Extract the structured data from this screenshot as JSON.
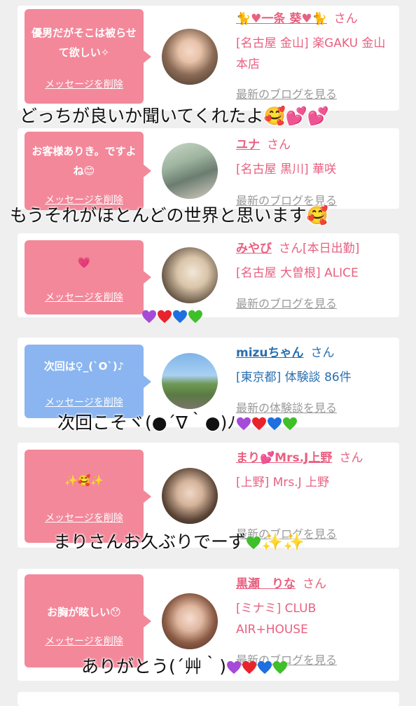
{
  "cards": [
    {
      "message": "優男だがそこは被らせて欲しい✧",
      "delete": "メッセージを削除",
      "name": "🐈♥一条 葵♥🐈",
      "san": "さん",
      "shop": "[名古屋 金山] 楽GAKU 金山本店",
      "blog": "最新のブログを見る"
    },
    {
      "message": "お客様ありき。ですよね😊",
      "delete": "メッセージを削除",
      "name": "ユナ",
      "san": "さん",
      "shop": "[名古屋 黒川] 華咲",
      "blog": "最新のブログを見る"
    },
    {
      "message": "💗",
      "delete": "メッセージを削除",
      "name": "みやび",
      "san": "さん[本日出勤]",
      "shop": "[名古屋 大曽根] ALICE",
      "blog": "最新のブログを見る"
    },
    {
      "message": "次回は♀_(`O`)♪",
      "delete": "メッセージを削除",
      "name": "mizuちゃん",
      "san": "さん",
      "shop": "[東京都] 体験談 86件",
      "blog": "最新の体験談を見る"
    },
    {
      "message": "✨🥰✨",
      "delete": "メッセージを削除",
      "name": "まり💕Mrs.J上野",
      "san": "さん",
      "shop": "[上野] Mrs.J 上野",
      "blog": "最新のブログを見る"
    },
    {
      "message": "お胸が眩しい😯",
      "delete": "メッセージを削除",
      "name": "黒瀬　りな",
      "san": "さん",
      "shop": "[ミナミ] CLUB AIR+HOUSE",
      "blog": "最新のブログを見る"
    }
  ],
  "captions": [
    "どっちが良いか聞いてくれたよ🥰💕💕",
    "もうそれがほとんどの世界と思います🥰",
    "次回こそヾ(●´∇｀●)ﾉ",
    "まりさんお久ぶりでーず",
    "ありがとう(´艸｀)"
  ],
  "colors": {
    "pink": "#f3889a",
    "blue": "#8ab5f0",
    "purple": "#a64ad8",
    "red": "#e8232b",
    "heart_blue": "#1e6fe0",
    "green": "#3fbf2a"
  }
}
